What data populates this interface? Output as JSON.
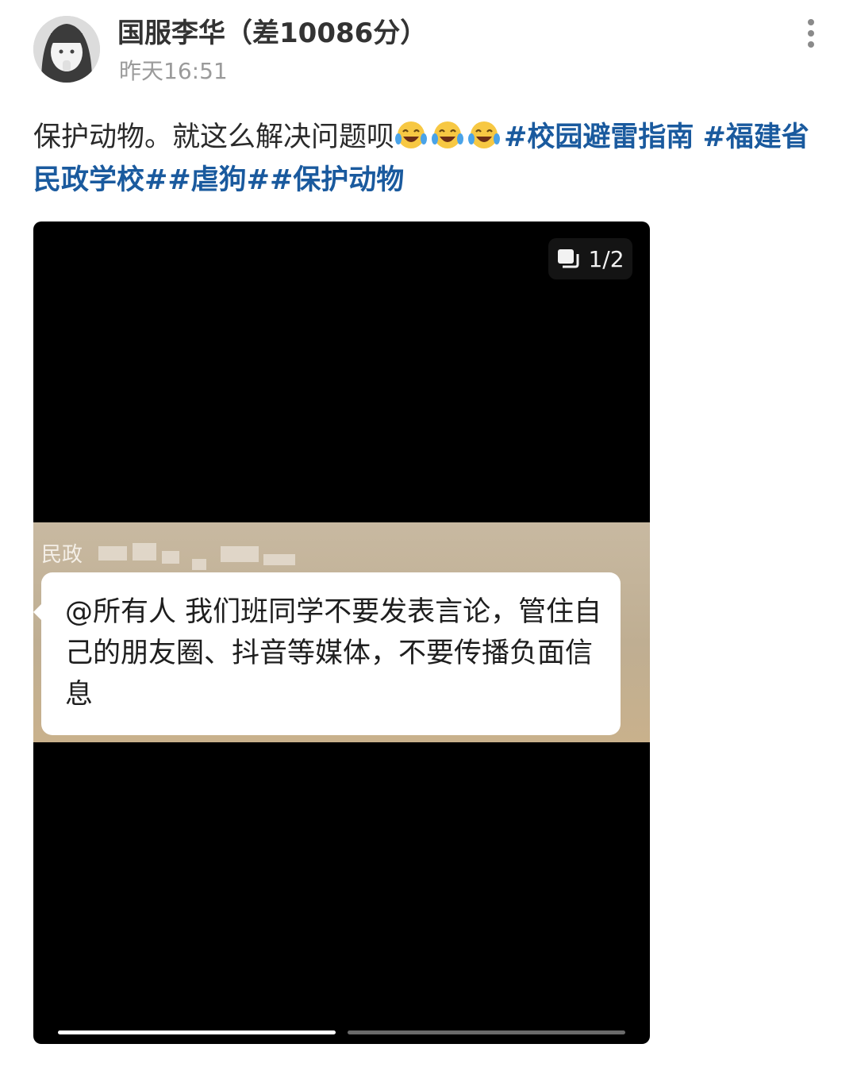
{
  "header": {
    "username": "国服李华（差10086分）",
    "timestamp": "昨天16:51"
  },
  "post": {
    "text_plain": "保护动物。就这么解决问题呗",
    "emojis": [
      "laughing-tears-emoji",
      "laughing-tears-emoji",
      "laughing-tears-emoji"
    ],
    "hashtags": [
      "#校园避雷指南",
      "#福建省民政学校#",
      "#虐狗#",
      "#保护动物"
    ]
  },
  "media": {
    "page_indicator": "1/2",
    "current_page": 1,
    "total_pages": 2,
    "chat_sender": "民政",
    "chat_message": "@所有人 我们班同学不要发表言论，管住自己的朋友圈、抖音等媒体，不要传播负面信息"
  },
  "colors": {
    "hashtag": "#1a5a9e",
    "media_background": "#000000",
    "chat_background": "#c8b9a1"
  }
}
